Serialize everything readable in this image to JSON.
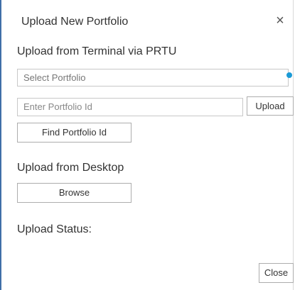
{
  "dialog": {
    "title": "Upload New Portfolio",
    "close_icon": "close-icon"
  },
  "terminal_section": {
    "heading": "Upload from Terminal via PRTU",
    "select_placeholder": "Select Portfolio",
    "portfolio_id_placeholder": "Enter Portfolio Id",
    "upload_label": "Upload",
    "find_label": "Find Portfolio Id"
  },
  "desktop_section": {
    "heading": "Upload from Desktop",
    "browse_label": "Browse"
  },
  "status": {
    "label": "Upload Status:"
  },
  "footer": {
    "close_label": "Close"
  },
  "colors": {
    "accent": "#1a9ad6",
    "dialog_border": "#3f6fa8"
  }
}
